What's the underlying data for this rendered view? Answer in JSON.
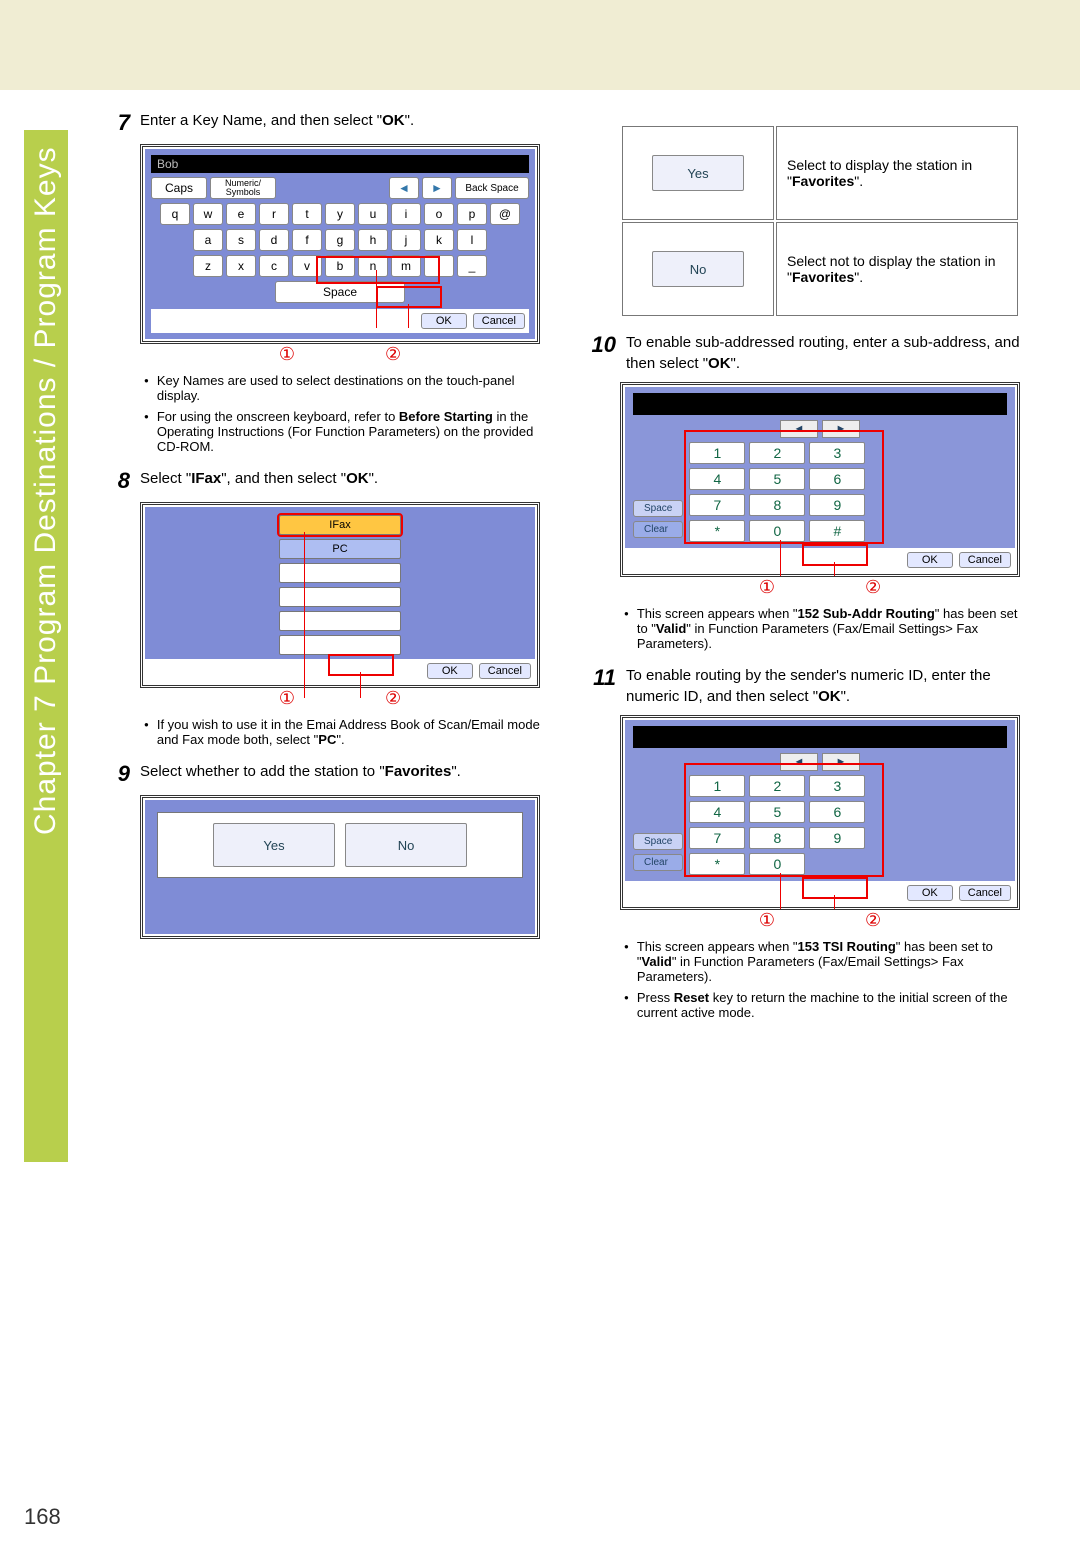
{
  "chapter_tab": "Chapter 7    Program Destinations / Program Keys",
  "page_number": "168",
  "steps": {
    "s7": {
      "num": "7",
      "text_a": "Enter a Key Name, and then select \"",
      "bold": "OK",
      "text_b": "\"."
    },
    "s8": {
      "num": "8",
      "text_a": "Select \"",
      "bold1": "IFax",
      "mid": "\", and then select \"",
      "bold2": "OK",
      "text_b": "\"."
    },
    "s9": {
      "num": "9",
      "text_a": "Select whether to add the station to \"",
      "bold": "Favorites",
      "text_b": "\"."
    },
    "s10": {
      "num": "10",
      "text_a": "To enable sub-addressed routing, enter a sub-address, and then select \"",
      "bold": "OK",
      "text_b": "\"."
    },
    "s11": {
      "num": "11",
      "text_a": "To enable routing by the sender's numeric ID, enter the numeric ID, and then select \"",
      "bold": "OK",
      "text_b": "\"."
    }
  },
  "bullets": {
    "s7a": "Key Names are used to select destinations on the touch-panel display.",
    "s7b_pre": "For using the onscreen keyboard, refer to ",
    "s7b_bold": "Before Starting",
    "s7b_post": " in the Operating Instructions (For Function Parameters) on the provided CD-ROM.",
    "s8a_pre": "If you wish to use it in the Emai Address Book of Scan/Email mode and Fax mode both, select \"",
    "s8a_bold": "PC",
    "s8a_post": "\".",
    "s10a_pre": "This screen appears when \"",
    "s10a_b1": "152 Sub-Addr Routing",
    "s10a_mid": "\" has been set to \"",
    "s10a_b2": "Valid",
    "s10a_post": "\" in Function Parameters (Fax/Email Settings> Fax Parameters).",
    "s11a_pre": "This screen appears when \"",
    "s11a_b1": "153 TSI Routing",
    "s11a_mid": "\" has been set to \"",
    "s11a_b2": "Valid",
    "s11a_post": "\" in Function Parameters (Fax/Email Settings> Fax Parameters).",
    "s11b_pre": "Press ",
    "s11b_bold": "Reset",
    "s11b_post": " key to return the machine to the initial screen of the current active mode."
  },
  "kbd": {
    "display_name": "Bob",
    "caps": "Caps",
    "ns": "Numeric/\nSymbols",
    "back": "Back Space",
    "space": "Space",
    "ok": "OK",
    "cancel": "Cancel",
    "row1": [
      "q",
      "w",
      "e",
      "r",
      "t",
      "y",
      "u",
      "i",
      "o",
      "p",
      "@"
    ],
    "row2": [
      "a",
      "s",
      "d",
      "f",
      "g",
      "h",
      "j",
      "k",
      "l"
    ],
    "row3": [
      "z",
      "x",
      "c",
      "v",
      "b",
      "n",
      "m",
      ".",
      "_"
    ]
  },
  "list": {
    "ifax": "IFax",
    "pc": "PC",
    "ok": "OK",
    "cancel": "Cancel"
  },
  "yesno": {
    "yes": "Yes",
    "no": "No"
  },
  "desc_yes_pre": "Select to display the station in \"",
  "desc_yes_bold": "Favorites",
  "desc_yes_post": "\".",
  "desc_no_pre": "Select not to display the station in \"",
  "desc_no_bold": "Favorites",
  "desc_no_post": "\".",
  "numpad": {
    "space": "Space",
    "clear": "Clear",
    "ok": "OK",
    "cancel": "Cancel",
    "keys": [
      "1",
      "2",
      "3",
      "4",
      "5",
      "6",
      "7",
      "8",
      "9",
      "*",
      "0",
      "#"
    ],
    "keys11": [
      "1",
      "2",
      "3",
      "4",
      "5",
      "6",
      "7",
      "8",
      "9",
      "*",
      "0"
    ]
  }
}
